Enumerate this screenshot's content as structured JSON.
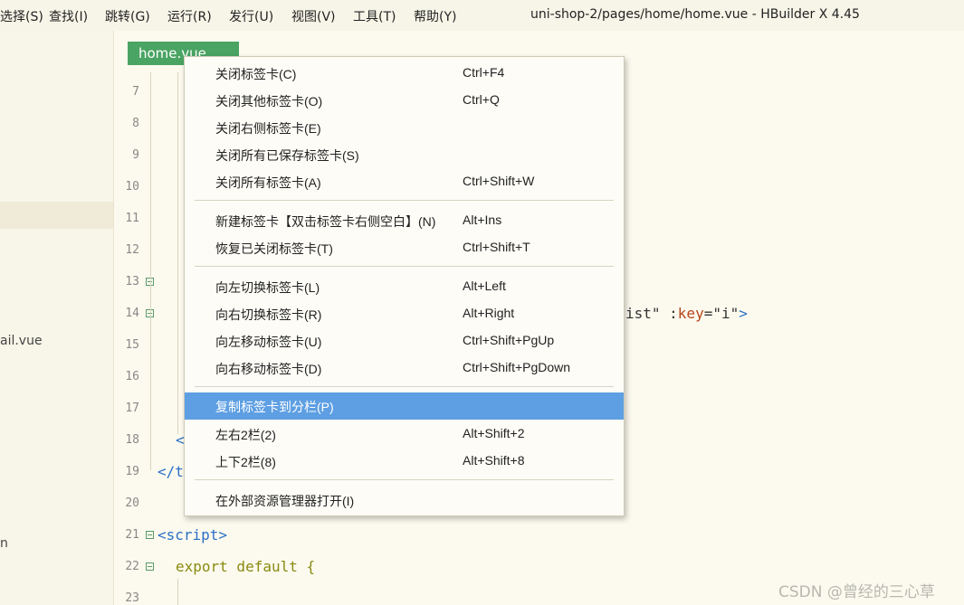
{
  "menubar": {
    "items": [
      "选择(S)",
      "查找(I)",
      "跳转(G)",
      "运行(R)",
      "发行(U)",
      "视图(V)",
      "工具(T)",
      "帮助(Y)"
    ],
    "window_title": "uni-shop-2/pages/home/home.vue - HBuilder X 4.45"
  },
  "sidebar": {
    "files": [
      "ail.vue",
      "n"
    ]
  },
  "editor": {
    "tab_label": "home.vue",
    "line_numbers": [
      "7",
      "8",
      "9",
      "10",
      "11",
      "12",
      "13",
      "14",
      "15",
      "16",
      "17",
      "18",
      "19",
      "20",
      "21",
      "22",
      "23"
    ],
    "code_lines": {
      "l14_tail": "ist\" :key=\"i\">",
      "l18": "<",
      "l19": "</t",
      "l21": "<script>",
      "l22": "export default {"
    }
  },
  "context_menu": {
    "groups": [
      [
        {
          "label": "关闭标签卡(C)",
          "shortcut": "Ctrl+F4"
        },
        {
          "label": "关闭其他标签卡(O)",
          "shortcut": "Ctrl+Q"
        },
        {
          "label": "关闭右侧标签卡(E)",
          "shortcut": ""
        },
        {
          "label": "关闭所有已保存标签卡(S)",
          "shortcut": ""
        },
        {
          "label": "关闭所有标签卡(A)",
          "shortcut": "Ctrl+Shift+W"
        }
      ],
      [
        {
          "label": "新建标签卡【双击标签卡右侧空白】(N)",
          "shortcut": "Alt+Ins"
        },
        {
          "label": "恢复已关闭标签卡(T)",
          "shortcut": "Ctrl+Shift+T"
        }
      ],
      [
        {
          "label": "向左切换标签卡(L)",
          "shortcut": "Alt+Left"
        },
        {
          "label": "向右切换标签卡(R)",
          "shortcut": "Alt+Right"
        },
        {
          "label": "向左移动标签卡(U)",
          "shortcut": "Ctrl+Shift+PgUp"
        },
        {
          "label": "向右移动标签卡(D)",
          "shortcut": "Ctrl+Shift+PgDown"
        }
      ],
      [
        {
          "label": "复制标签卡到分栏(P)",
          "shortcut": ""
        },
        {
          "label": "左右2栏(2)",
          "shortcut": "Alt+Shift+2"
        },
        {
          "label": "上下2栏(8)",
          "shortcut": "Alt+Shift+8"
        }
      ],
      [
        {
          "label": "在外部资源管理器打开(I)",
          "shortcut": ""
        }
      ]
    ],
    "highlighted_item": "复制标签卡到分栏(P)"
  },
  "watermark": "CSDN @曾经的三心草",
  "colors": {
    "tab_active": "#4aa463",
    "menu_highlight": "#5e9fe3",
    "editor_bg": "#fcfaee",
    "tag": "#2b6fc7",
    "keyword": "#8a8a10",
    "attribute": "#b8431b"
  }
}
